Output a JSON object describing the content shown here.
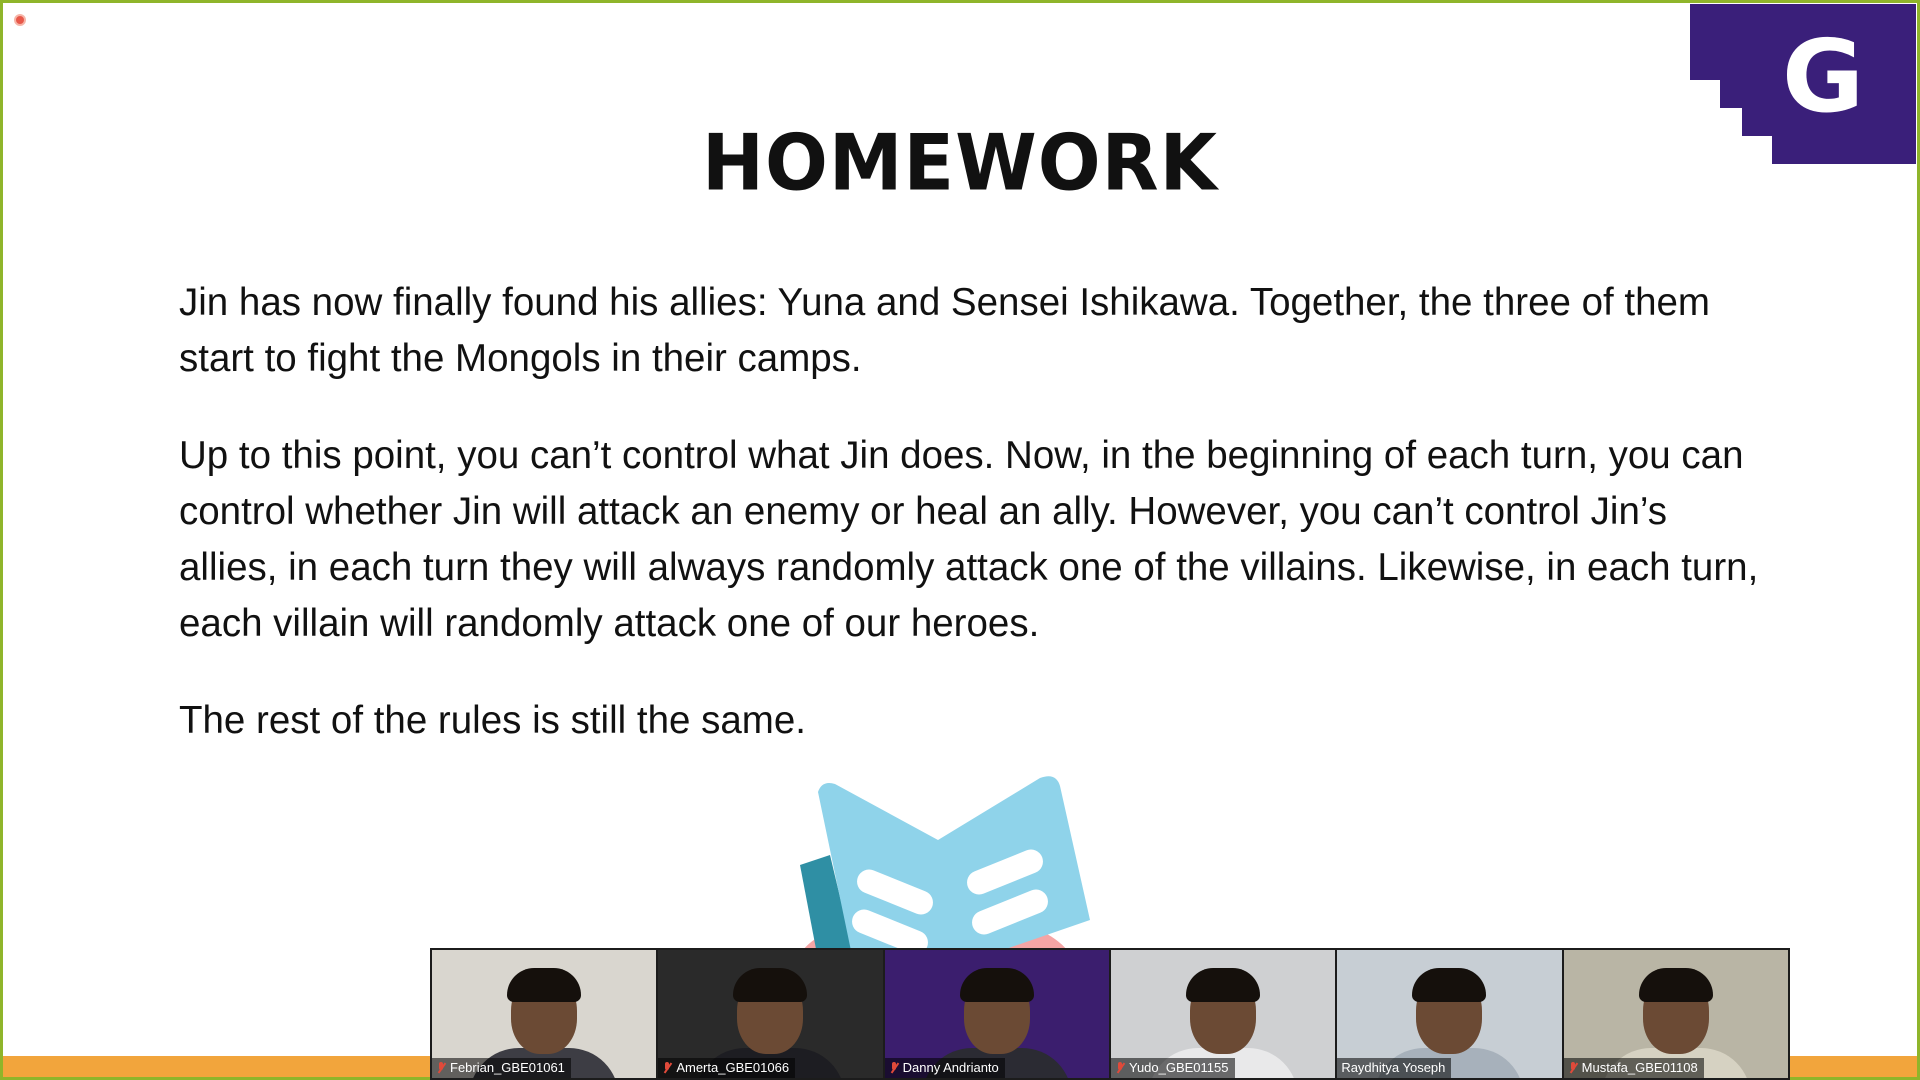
{
  "slide": {
    "title": "HOMEWORK",
    "paragraphs": [
      "Jin has now finally found his allies: Yuna and Sensei Ishikawa. Together, the three of them start to fight the Mongols in their camps.",
      "Up to this point, you can’t control what Jin does. Now, in the beginning of each turn, you can control whether Jin will attack an enemy or heal an ally. However, you can’t control Jin’s allies, in each turn they will always randomly attack one of the villains. Likewise, in each turn, each villain will randomly attack one of our heroes.",
      "The rest of the rules is still the same."
    ],
    "logo_letter": "G",
    "logo_color": "#3a1f7a",
    "book_color": "#8fd3ea",
    "accent_bar_color": "#f2a53c",
    "border_color": "#8fb52a"
  },
  "gallery": {
    "participants": [
      {
        "name": "Febrian_GBE01061",
        "muted": true,
        "bg": "#d9d6cf",
        "shirt": "#3d3d44"
      },
      {
        "name": "Amerta_GBE01066",
        "muted": true,
        "bg": "#2a2a2a",
        "shirt": "#1d1d22"
      },
      {
        "name": "Danny Andrianto",
        "muted": true,
        "bg": "#3b1e6e",
        "shirt": "#2b2b33"
      },
      {
        "name": "Yudo_GBE01155",
        "muted": true,
        "bg": "#cfd0d2",
        "shirt": "#e9e9ea"
      },
      {
        "name": "Raydhitya Yoseph",
        "muted": false,
        "bg": "#c7ced4",
        "shirt": "#a7b1bb"
      },
      {
        "name": "Mustafa_GBE01108",
        "muted": true,
        "bg": "#b9b5a5",
        "shirt": "#d6d2c2"
      }
    ]
  }
}
